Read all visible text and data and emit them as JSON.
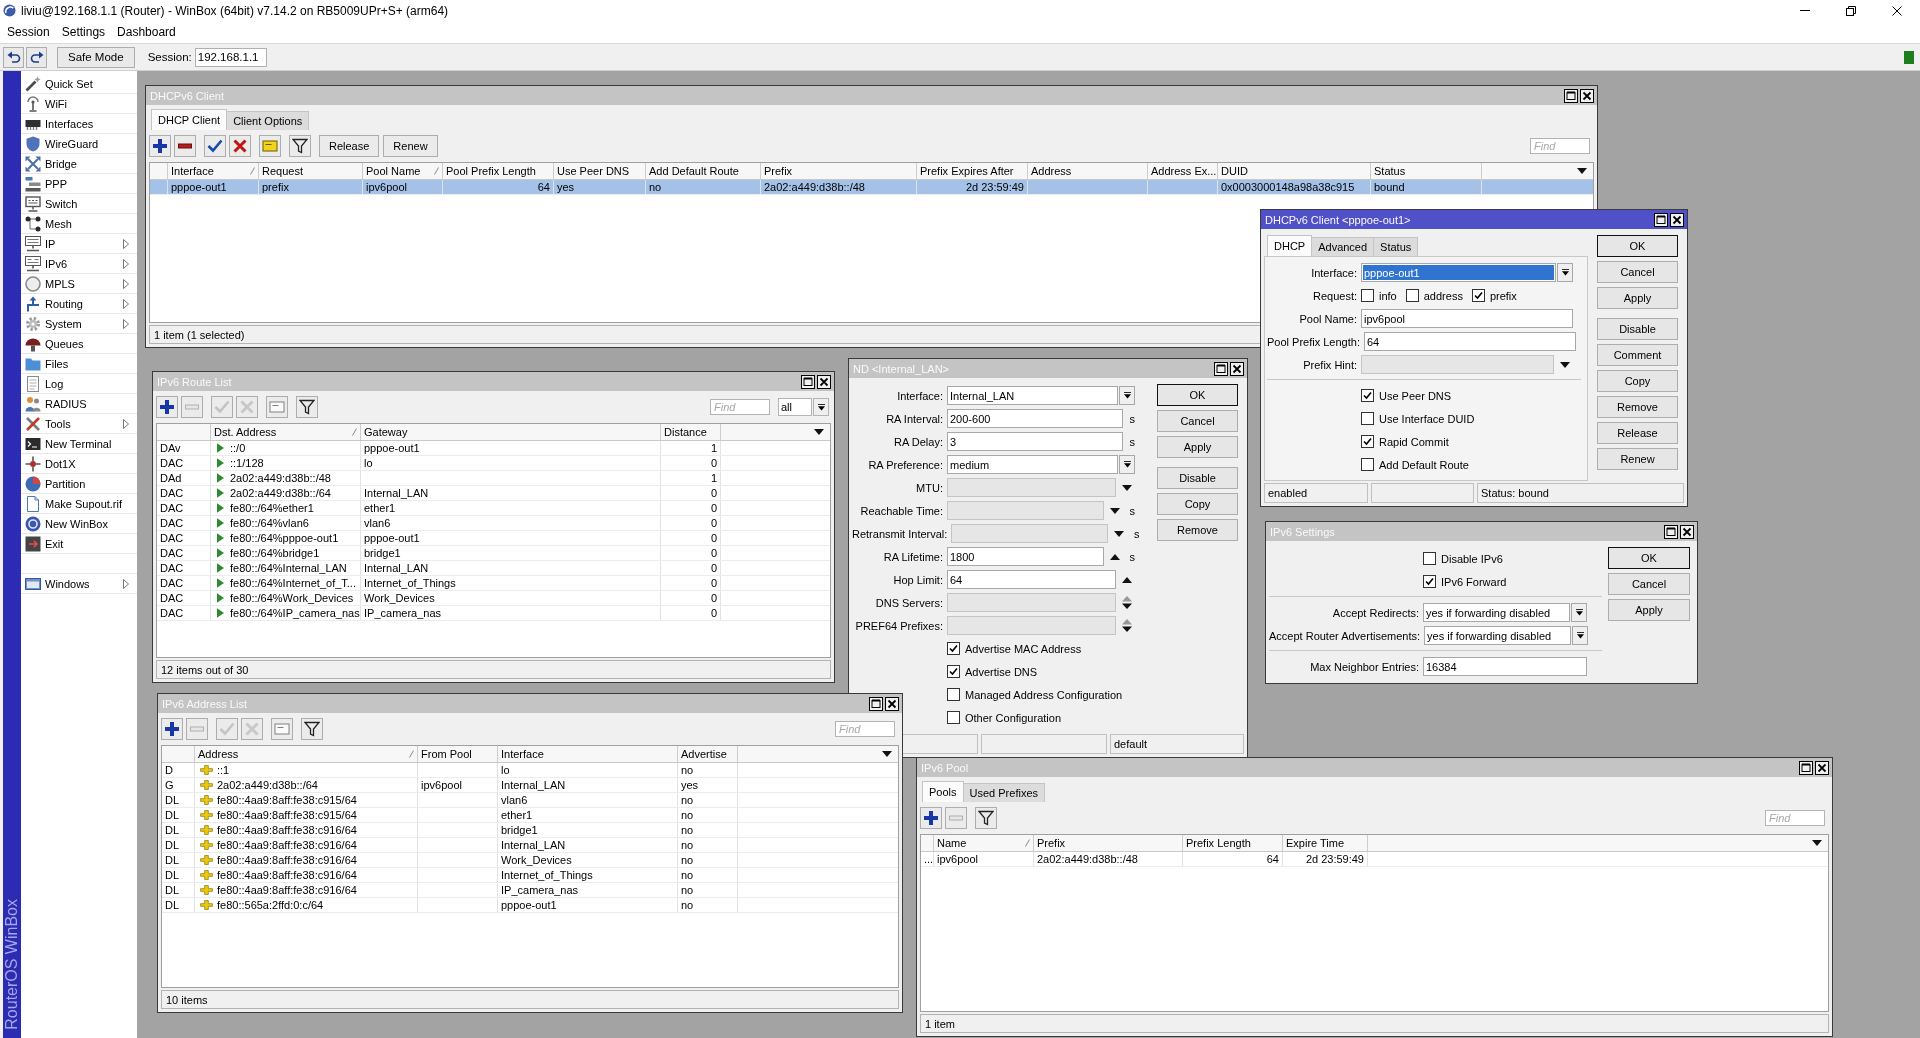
{
  "window": {
    "title": "liviu@192.168.1.1 (Router) - WinBox (64bit) v7.14.2 on RB5009UPr+S+ (arm64)"
  },
  "menu": [
    "Session",
    "Settings",
    "Dashboard"
  ],
  "toolbar": {
    "safe_mode": "Safe Mode",
    "session_label": "Session:",
    "session": "192.168.1.1"
  },
  "sidebar": {
    "items": [
      {
        "label": "Quick Set",
        "submenu": false
      },
      {
        "label": "WiFi",
        "submenu": false
      },
      {
        "label": "Interfaces",
        "submenu": false
      },
      {
        "label": "WireGuard",
        "submenu": false
      },
      {
        "label": "Bridge",
        "submenu": false
      },
      {
        "label": "PPP",
        "submenu": false
      },
      {
        "label": "Switch",
        "submenu": false
      },
      {
        "label": "Mesh",
        "submenu": false
      },
      {
        "label": "IP",
        "submenu": true
      },
      {
        "label": "IPv6",
        "submenu": true
      },
      {
        "label": "MPLS",
        "submenu": true
      },
      {
        "label": "Routing",
        "submenu": true
      },
      {
        "label": "System",
        "submenu": true
      },
      {
        "label": "Queues",
        "submenu": false
      },
      {
        "label": "Files",
        "submenu": false
      },
      {
        "label": "Log",
        "submenu": false
      },
      {
        "label": "RADIUS",
        "submenu": false
      },
      {
        "label": "Tools",
        "submenu": true
      },
      {
        "label": "New Terminal",
        "submenu": false
      },
      {
        "label": "Dot1X",
        "submenu": false
      },
      {
        "label": "Partition",
        "submenu": false
      },
      {
        "label": "Make Supout.rif",
        "submenu": false
      },
      {
        "label": "New WinBox",
        "submenu": false
      },
      {
        "label": "Exit",
        "submenu": false
      }
    ],
    "footer_items": [
      {
        "label": "Windows",
        "submenu": true
      }
    ],
    "brand": "RouterOS WinBox"
  },
  "windows": [
    {
      "kind": "list",
      "title": "DHCPv6 Client",
      "active": false,
      "tabs": [
        {
          "label": "DHCP Client",
          "selected": true
        },
        {
          "label": "Client Options",
          "selected": false
        }
      ],
      "tools": [
        {
          "kind": "add",
          "disabled": false
        },
        {
          "kind": "remove",
          "disabled": false
        },
        {
          "kind": "enable",
          "disabled": false
        },
        {
          "kind": "disable",
          "disabled": false
        },
        {
          "kind": "comment",
          "disabled": false
        },
        {
          "kind": "filter",
          "disabled": false
        }
      ],
      "actions": [
        "Release",
        "Renew"
      ],
      "find": {
        "placeholder": "Find"
      },
      "columns": [
        {
          "label": "Interface",
          "sorted": true
        },
        {
          "label": "Request",
          "sorted": false
        },
        {
          "label": "Pool Name",
          "sorted": true
        },
        {
          "label": "Pool Prefix Length",
          "sorted": false
        },
        {
          "label": "Use Peer DNS",
          "sorted": false
        },
        {
          "label": "Add Default Route",
          "sorted": false
        },
        {
          "label": "Prefix",
          "sorted": false
        },
        {
          "label": "Prefix Expires After",
          "sorted": false
        },
        {
          "label": "Address",
          "sorted": false
        },
        {
          "label": "Address Ex...",
          "sorted": false
        },
        {
          "label": "DUID",
          "sorted": false
        },
        {
          "label": "Status",
          "sorted": false
        }
      ],
      "rows": [
        {
          "selected": true,
          "cells": [
            "pppoe-out1",
            "prefix",
            "ipv6pool",
            "64",
            "yes",
            "no",
            "2a02:a449:d38b::/48",
            "2d 23:59:49",
            null,
            null,
            "0x0003000148a98a38c915",
            "bound"
          ]
        }
      ],
      "status": "1 item (1 selected)"
    },
    {
      "kind": "dialog",
      "title": "DHCPv6 Client <pppoe-out1>",
      "active": true,
      "tabs": [
        {
          "label": "DHCP",
          "selected": true
        },
        {
          "label": "Advanced",
          "selected": false
        },
        {
          "label": "Status",
          "selected": false
        }
      ],
      "fields": [
        {
          "kind": "dropdown",
          "label": "Interface:",
          "value": "pppoe-out1",
          "highlighted": true
        },
        {
          "kind": "checks",
          "label": "Request:",
          "options": [
            {
              "label": "info",
              "checked": false
            },
            {
              "label": "address",
              "checked": false
            },
            {
              "label": "prefix",
              "checked": true
            }
          ]
        },
        {
          "kind": "text",
          "label": "Pool Name:",
          "value": "ipv6pool"
        },
        {
          "kind": "text",
          "label": "Pool Prefix Length:",
          "value": "64"
        },
        {
          "kind": "unset",
          "label": "Prefix Hint:"
        },
        {
          "kind": "separator"
        },
        {
          "kind": "checkbox",
          "label": "Use Peer DNS",
          "checked": true
        },
        {
          "kind": "checkbox",
          "label": "Use Interface DUID",
          "checked": false
        },
        {
          "kind": "checkbox",
          "label": "Rapid Commit",
          "checked": true
        },
        {
          "kind": "checkbox",
          "label": "Add Default Route",
          "checked": false
        }
      ],
      "button_groups": [
        [
          {
            "label": "OK",
            "default": true
          },
          {
            "label": "Cancel",
            "default": false
          },
          {
            "label": "Apply",
            "default": false
          }
        ],
        [
          {
            "label": "Disable",
            "default": false
          },
          {
            "label": "Comment",
            "default": false
          },
          {
            "label": "Copy",
            "default": false
          },
          {
            "label": "Remove",
            "default": false
          },
          {
            "label": "Release",
            "default": false
          },
          {
            "label": "Renew",
            "default": false
          }
        ]
      ],
      "status_bar": {
        "cell_1": "enabled",
        "cell_3": "Status: bound"
      }
    },
    {
      "kind": "list",
      "title": "IPv6 Route List",
      "active": false,
      "tools": [
        {
          "kind": "add",
          "disabled": false
        },
        {
          "kind": "remove",
          "disabled": true
        },
        {
          "kind": "enable",
          "disabled": true
        },
        {
          "kind": "disable",
          "disabled": true
        },
        {
          "kind": "comment",
          "disabled": true
        },
        {
          "kind": "filter",
          "disabled": false
        }
      ],
      "find": {
        "placeholder": "Find"
      },
      "filter_select": {
        "value": "all"
      },
      "columns": [
        {
          "label": "Dst. Address",
          "sorted": true
        },
        {
          "label": "Gateway",
          "sorted": false
        },
        {
          "label": "Distance",
          "sorted": false
        }
      ],
      "rows": [
        {
          "selected": false,
          "flags": "DAv",
          "cells": [
            "::/0",
            "pppoe-out1",
            "1"
          ]
        },
        {
          "selected": false,
          "flags": "DAC",
          "cells": [
            "::1/128",
            "lo",
            "0"
          ]
        },
        {
          "selected": false,
          "flags": "DAd",
          "cells": [
            "2a02:a449:d38b::/48",
            null,
            "1"
          ]
        },
        {
          "selected": false,
          "flags": "DAC",
          "cells": [
            "2a02:a449:d38b::/64",
            "Internal_LAN",
            "0"
          ]
        },
        {
          "selected": false,
          "flags": "DAC",
          "cells": [
            "fe80::/64%ether1",
            "ether1",
            "0"
          ]
        },
        {
          "selected": false,
          "flags": "DAC",
          "cells": [
            "fe80::/64%vlan6",
            "vlan6",
            "0"
          ]
        },
        {
          "selected": false,
          "flags": "DAC",
          "cells": [
            "fe80::/64%pppoe-out1",
            "pppoe-out1",
            "0"
          ]
        },
        {
          "selected": false,
          "flags": "DAC",
          "cells": [
            "fe80::/64%bridge1",
            "bridge1",
            "0"
          ]
        },
        {
          "selected": false,
          "flags": "DAC",
          "cells": [
            "fe80::/64%Internal_LAN",
            "Internal_LAN",
            "0"
          ]
        },
        {
          "selected": false,
          "flags": "DAC",
          "cells": [
            "fe80::/64%Internet_of_T...",
            "Internet_of_Things",
            "0"
          ]
        },
        {
          "selected": false,
          "flags": "DAC",
          "cells": [
            "fe80::/64%Work_Devices",
            "Work_Devices",
            "0"
          ]
        },
        {
          "selected": false,
          "flags": "DAC",
          "cells": [
            "fe80::/64%IP_camera_nas",
            "IP_camera_nas",
            "0"
          ]
        }
      ],
      "status": "12 items out of 30"
    },
    {
      "kind": "dialog",
      "title": "ND <Internal_LAN>",
      "active": false,
      "fields": [
        {
          "kind": "dropdown",
          "label": "Interface:",
          "value": "Internal_LAN",
          "highlighted": false
        },
        {
          "kind": "text",
          "label": "RA Interval:",
          "value": "200-600",
          "unit": "s"
        },
        {
          "kind": "text",
          "label": "RA Delay:",
          "value": "3",
          "unit": "s"
        },
        {
          "kind": "dropdown",
          "label": "RA Preference:",
          "value": "medium",
          "highlighted": false
        },
        {
          "kind": "unset",
          "label": "MTU:"
        },
        {
          "kind": "unset",
          "label": "Reachable Time:",
          "unit": "s"
        },
        {
          "kind": "unset",
          "label": "Retransmit Interval:",
          "unit": "s"
        },
        {
          "kind": "set",
          "label": "RA Lifetime:",
          "value": "1800",
          "unit": "s"
        },
        {
          "kind": "set",
          "label": "Hop Limit:",
          "value": "64"
        },
        {
          "kind": "multi",
          "label": "DNS Servers:"
        },
        {
          "kind": "multi",
          "label": "PREF64 Prefixes:"
        },
        {
          "kind": "checkbox",
          "label": "Advertise MAC Address",
          "checked": true
        },
        {
          "kind": "checkbox",
          "label": "Advertise DNS",
          "checked": true
        },
        {
          "kind": "checkbox",
          "label": "Managed Address Configuration",
          "checked": false
        },
        {
          "kind": "checkbox",
          "label": "Other Configuration",
          "checked": false
        }
      ],
      "button_groups": [
        [
          {
            "label": "OK",
            "default": true
          },
          {
            "label": "Cancel",
            "default": false
          },
          {
            "label": "Apply",
            "default": false
          }
        ],
        [
          {
            "label": "Disable",
            "default": false
          },
          {
            "label": "Copy",
            "default": false
          },
          {
            "label": "Remove",
            "default": false
          }
        ]
      ],
      "status_bar": {
        "cell_3": "default"
      }
    },
    {
      "kind": "dialog",
      "title": "IPv6 Settings",
      "active": false,
      "fields": [
        {
          "kind": "checkbox",
          "label": "Disable IPv6",
          "checked": false
        },
        {
          "kind": "checkbox",
          "label": "IPv6 Forward",
          "checked": true
        },
        {
          "kind": "separator"
        },
        {
          "kind": "dropdown",
          "label": "Accept Redirects:",
          "value": "yes if forwarding disabled",
          "highlighted": false
        },
        {
          "kind": "dropdown",
          "label": "Accept Router Advertisements:",
          "value": "yes if forwarding disabled",
          "highlighted": false
        },
        {
          "kind": "separator"
        },
        {
          "kind": "text",
          "label": "Max Neighbor Entries:",
          "value": "16384"
        }
      ],
      "button_groups": [
        [
          {
            "label": "OK",
            "default": true
          },
          {
            "label": "Cancel",
            "default": false
          },
          {
            "label": "Apply",
            "default": false
          }
        ]
      ]
    },
    {
      "kind": "list",
      "title": "IPv6 Address List",
      "active": false,
      "tools": [
        {
          "kind": "add",
          "disabled": false
        },
        {
          "kind": "remove",
          "disabled": true
        },
        {
          "kind": "enable",
          "disabled": true
        },
        {
          "kind": "disable",
          "disabled": true
        },
        {
          "kind": "comment",
          "disabled": true
        },
        {
          "kind": "filter",
          "disabled": false
        }
      ],
      "find": {
        "placeholder": "Find"
      },
      "columns": [
        {
          "label": "Address",
          "sorted": true
        },
        {
          "label": "From Pool",
          "sorted": false
        },
        {
          "label": "Interface",
          "sorted": false
        },
        {
          "label": "Advertise",
          "sorted": false
        }
      ],
      "rows": [
        {
          "selected": false,
          "flags": "D",
          "cells": [
            "::1",
            null,
            "lo",
            "no"
          ]
        },
        {
          "selected": false,
          "flags": "G",
          "cells": [
            "2a02:a449:d38b::/64",
            "ipv6pool",
            "Internal_LAN",
            "yes"
          ]
        },
        {
          "selected": false,
          "flags": "DL",
          "cells": [
            "fe80::4aa9:8aff:fe38:c915/64",
            null,
            "vlan6",
            "no"
          ]
        },
        {
          "selected": false,
          "flags": "DL",
          "cells": [
            "fe80::4aa9:8aff:fe38:c915/64",
            null,
            "ether1",
            "no"
          ]
        },
        {
          "selected": false,
          "flags": "DL",
          "cells": [
            "fe80::4aa9:8aff:fe38:c916/64",
            null,
            "bridge1",
            "no"
          ]
        },
        {
          "selected": false,
          "flags": "DL",
          "cells": [
            "fe80::4aa9:8aff:fe38:c916/64",
            null,
            "Internal_LAN",
            "no"
          ]
        },
        {
          "selected": false,
          "flags": "DL",
          "cells": [
            "fe80::4aa9:8aff:fe38:c916/64",
            null,
            "Work_Devices",
            "no"
          ]
        },
        {
          "selected": false,
          "flags": "DL",
          "cells": [
            "fe80::4aa9:8aff:fe38:c916/64",
            null,
            "Internet_of_Things",
            "no"
          ]
        },
        {
          "selected": false,
          "flags": "DL",
          "cells": [
            "fe80::4aa9:8aff:fe38:c916/64",
            null,
            "IP_camera_nas",
            "no"
          ]
        },
        {
          "selected": false,
          "flags": "DL",
          "cells": [
            "fe80::565a:2ffd:0:c/64",
            null,
            "pppoe-out1",
            "no"
          ]
        }
      ],
      "status": "10 items"
    },
    {
      "kind": "list",
      "title": "IPv6 Pool",
      "active": false,
      "tabs": [
        {
          "label": "Pools",
          "selected": true
        },
        {
          "label": "Used Prefixes",
          "selected": false
        }
      ],
      "tools": [
        {
          "kind": "add",
          "disabled": false
        },
        {
          "kind": "remove",
          "disabled": true
        },
        {
          "kind": "filter",
          "disabled": false
        }
      ],
      "find": {
        "placeholder": "Find"
      },
      "columns": [
        {
          "label": "Name",
          "sorted": true
        },
        {
          "label": "Prefix",
          "sorted": false
        },
        {
          "label": "Prefix Length",
          "sorted": false
        },
        {
          "label": "Expire Time",
          "sorted": false
        }
      ],
      "rows": [
        {
          "selected": false,
          "flags": "...",
          "cells": [
            "ipv6pool",
            "2a02:a449:d38b::/48",
            "64",
            "2d 23:59:49"
          ]
        }
      ],
      "status": "1 item"
    }
  ]
}
